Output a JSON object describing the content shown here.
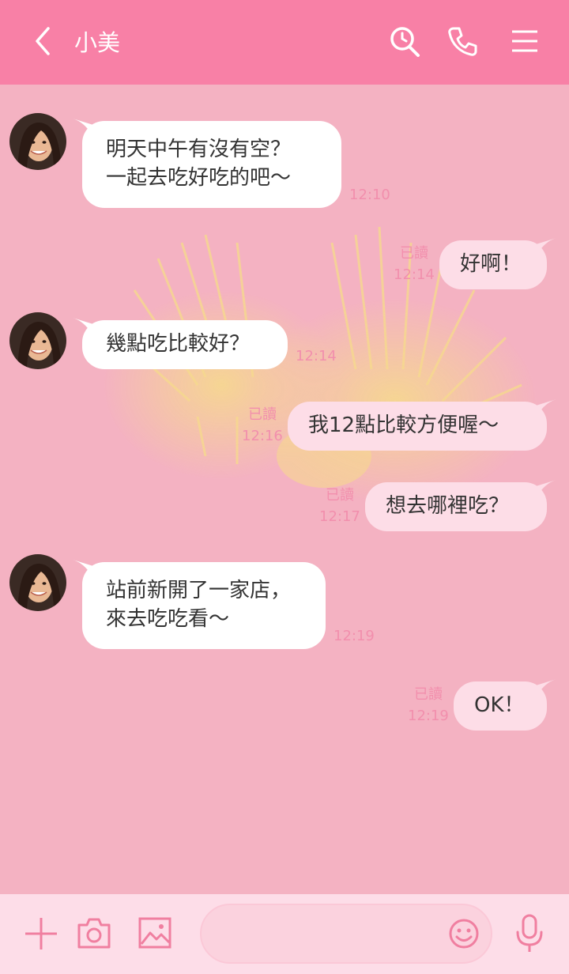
{
  "header": {
    "title": "小美",
    "back_icon": "chevron-left-icon",
    "search_icon": "search-icon",
    "call_icon": "phone-icon",
    "menu_icon": "hamburger-menu-icon"
  },
  "messages": [
    {
      "side": "in",
      "lines": [
        "明天中午有沒有空？",
        "一起去吃好吃的吧～"
      ],
      "time": "12:10"
    },
    {
      "side": "out",
      "text": "好啊！",
      "read": "已讀",
      "time": "12:14"
    },
    {
      "side": "in",
      "text": "幾點吃比較好？",
      "time": "12:14"
    },
    {
      "side": "out",
      "text": "我12點比較方便喔～",
      "read": "已讀",
      "time": "12:16"
    },
    {
      "side": "out",
      "text": "想去哪裡吃？",
      "read": "已讀",
      "time": "12:17"
    },
    {
      "side": "in",
      "lines": [
        "站前新開了一家店，",
        "來去吃吃看～"
      ],
      "time": "12:19"
    },
    {
      "side": "out",
      "text": "OK！",
      "read": "已讀",
      "time": "12:19"
    }
  ],
  "footer": {
    "plus_icon": "plus-icon",
    "camera_icon": "camera-icon",
    "image_icon": "image-icon",
    "input_placeholder": "",
    "emoji_icon": "emoji-icon",
    "mic_icon": "microphone-icon"
  },
  "colors": {
    "header": "#F880A6",
    "background": "#F4B2C2",
    "bubble_out": "#FDDDE7",
    "accent": "#F28FAD"
  }
}
